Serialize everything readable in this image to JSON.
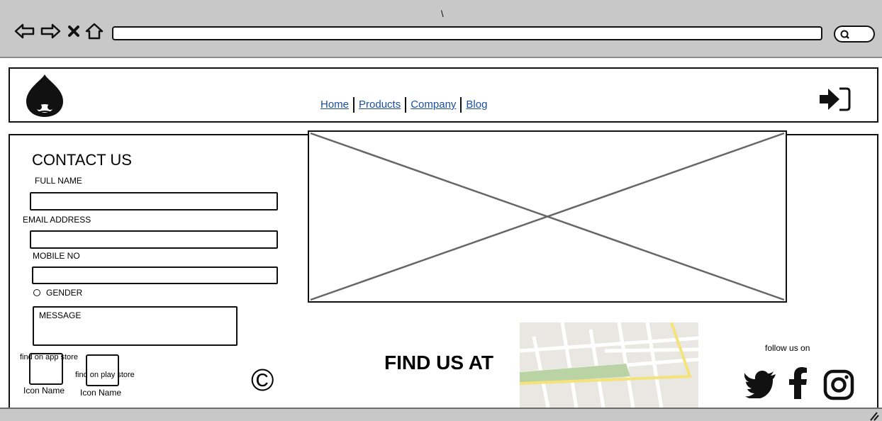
{
  "browser": {
    "back_icon": "back-arrow-icon",
    "forward_icon": "forward-arrow-icon",
    "close_icon": "close-icon",
    "home_icon": "home-icon",
    "search_icon": "search-icon",
    "tab_mark": "\\"
  },
  "header": {
    "logo_icon": "drupal-logo-icon",
    "nav": [
      "Home",
      "Products",
      "Company",
      "Blog"
    ],
    "login_icon": "sign-in-icon"
  },
  "contact": {
    "title": "CONTACT US",
    "full_name_label": "FULL NAME",
    "email_label": "EMAIL ADDRESS",
    "mobile_label": "MOBILE NO",
    "gender_label": "GENDER",
    "message_label": "MESSAGE"
  },
  "footer": {
    "app_store_text": "find on app store",
    "play_store_text": "find on play store",
    "icon_name_1": "Icon Name",
    "icon_name_2": "Icon Name",
    "copyright_symbol": "©",
    "find_us_title": "FIND US AT",
    "follow_text": "follow us on",
    "social_icons": [
      "twitter-icon",
      "facebook-icon",
      "instagram-icon"
    ]
  },
  "colors": {
    "chrome": "#c8c8c8",
    "link": "#1d4fa0",
    "map_bg": "#e9e7e1",
    "map_park": "#b9d3a5",
    "map_road": "#f4e27a"
  }
}
